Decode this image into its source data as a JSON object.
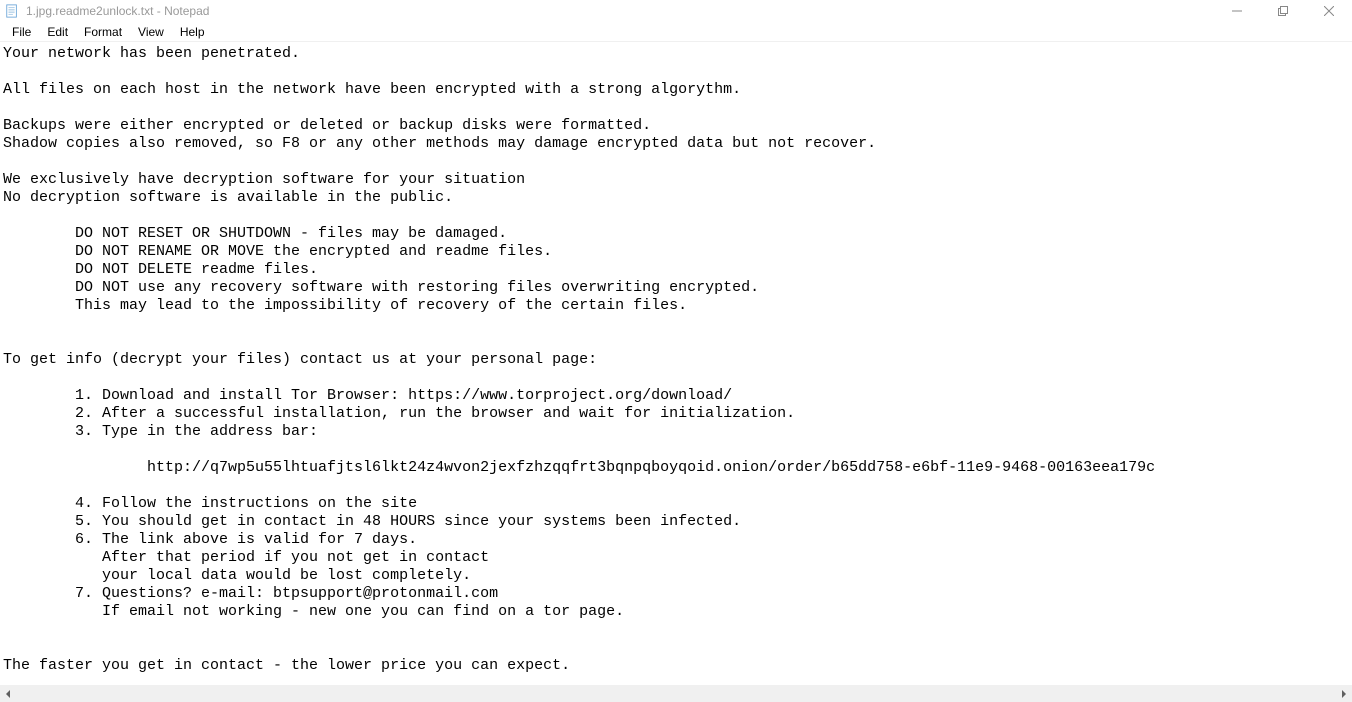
{
  "titlebar": {
    "title": "1.jpg.readme2unlock.txt - Notepad"
  },
  "menubar": {
    "file": "File",
    "edit": "Edit",
    "format": "Format",
    "view": "View",
    "help": "Help"
  },
  "editor": {
    "content": "Your network has been penetrated.\n\nAll files on each host in the network have been encrypted with a strong algorythm.\n\nBackups were either encrypted or deleted or backup disks were formatted.\nShadow copies also removed, so F8 or any other methods may damage encrypted data but not recover.\n\nWe exclusively have decryption software for your situation\nNo decryption software is available in the public.\n\n        DO NOT RESET OR SHUTDOWN - files may be damaged.\n        DO NOT RENAME OR MOVE the encrypted and readme files.\n        DO NOT DELETE readme files.\n        DO NOT use any recovery software with restoring files overwriting encrypted.\n        This may lead to the impossibility of recovery of the certain files.\n\n\nTo get info (decrypt your files) contact us at your personal page:\n\n        1. Download and install Tor Browser: https://www.torproject.org/download/\n        2. After a successful installation, run the browser and wait for initialization.\n        3. Type in the address bar:\n\n                http://q7wp5u55lhtuafjtsl6lkt24z4wvon2jexfzhzqqfrt3bqnpqboyqoid.onion/order/b65dd758-e6bf-11e9-9468-00163eea179c\n\n        4. Follow the instructions on the site\n        5. You should get in contact in 48 HOURS since your systems been infected.\n        6. The link above is valid for 7 days.\n           After that period if you not get in contact\n           your local data would be lost completely.\n        7. Questions? e-mail: btpsupport@protonmail.com\n           If email not working - new one you can find on a tor page.\n\n\nThe faster you get in contact - the lower price you can expect."
  }
}
